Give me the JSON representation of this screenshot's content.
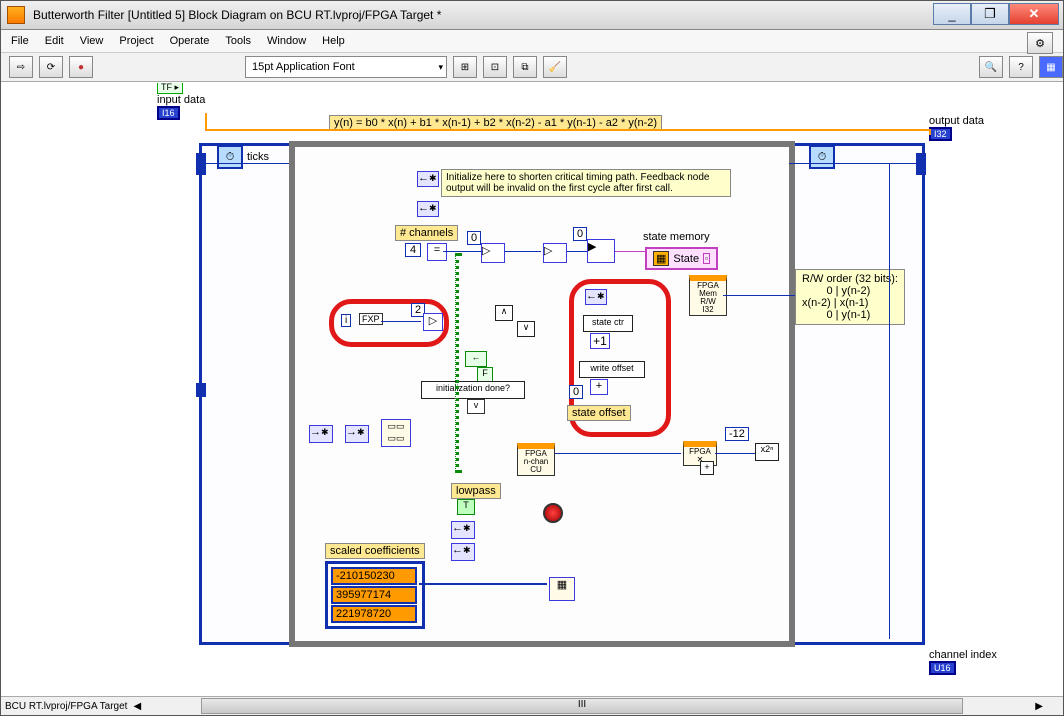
{
  "window": {
    "title": "Butterworth Filter [Untitled 5] Block Diagram on BCU RT.lvproj/FPGA Target *",
    "min_tip": "_",
    "max_tip": "❐",
    "close_tip": "✕"
  },
  "menu": {
    "file": "File",
    "edit": "Edit",
    "view": "View",
    "project": "Project",
    "operate": "Operate",
    "tools": "Tools",
    "window": "Window",
    "help": "Help"
  },
  "toolbar": {
    "run_arrow": "⇨",
    "run_cont": "⟳",
    "abort": "●",
    "font_label": "15pt Application Font",
    "align": "⊞",
    "distribute": "⊡",
    "reorder": "⧉",
    "cleanup": "🧹",
    "search": "🔍",
    "help_btn": "?",
    "palette": "▦"
  },
  "diagram": {
    "input_data": "input data",
    "output_data": "output data",
    "channel_index": "channel index",
    "formula": "y(n) = b0 * x(n) + b1 * x(n-1) + b2 * x(n-2) - a1 * y(n-1) - a2 * y(n-2)",
    "ticks": "ticks",
    "channels": "# channels",
    "channels_val": "4",
    "state_memory": "state memory",
    "state_label": " State",
    "zero_a": "0",
    "zero_b": "0",
    "zero_c": "0",
    "two": "2",
    "fxp": "FXP",
    "i_label": "i",
    "init_done": "initialization done?",
    "state_ctr": "state ctr",
    "write_offset": "write offset",
    "state_offset": "state offset",
    "lowpass": "lowpass",
    "true_sym": "T",
    "v_sym": "v",
    "coeff_title": "scaled coefficients",
    "coeff_0": "-210150230",
    "coeff_1": "395977174",
    "coeff_2": "221978720",
    "neg12": "-12",
    "tip": "Initialize here to shorten critical timing path. Feedback node output will be invalid on the first cycle after first call.",
    "rw_block": "R/W order (32 bits):\n        0 | y(n-2)\nx(n-2) | x(n-1)\n        0 | y(n-1)",
    "fpga_mem": "FPGA\nMem\nR/W\nI32",
    "fpga_cu": "FPGA\nn-chan\nCU",
    "fpga_x": "FPGA\n✕",
    "plus": "+",
    "x2": "x2ⁿ",
    "i16": "I16",
    "i32": "I32",
    "u16": "U16",
    "tf": "TF ▸",
    "av_a": "∧",
    "av_v": "∨",
    "av_f": "F"
  },
  "status": {
    "project": "BCU RT.lvproj/FPGA Target",
    "scroll_l": "◀",
    "scroll_r": "▶",
    "thumb": "III"
  }
}
